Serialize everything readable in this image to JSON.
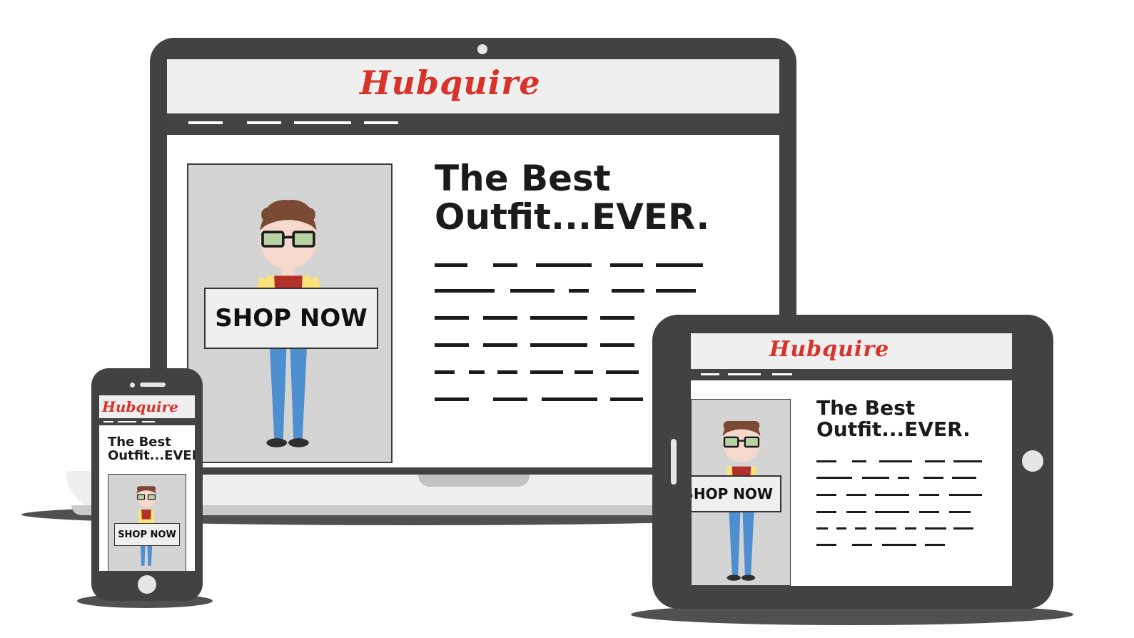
{
  "brand": {
    "logo_text": "Hubquire",
    "logo_color": "#d8332a"
  },
  "laptop": {
    "headline_line1": "The Best",
    "headline_line2": "Outfit...EVER.",
    "cta_label": "SHOP NOW"
  },
  "tablet": {
    "headline_line1": "The Best",
    "headline_line2": "Outfit...EVER.",
    "cta_label": "SHOP NOW"
  },
  "phone": {
    "headline_line1": "The Best",
    "headline_line2": "Outfit...EVER",
    "cta_label": "SHOP NOW"
  },
  "colors": {
    "frame": "#424242",
    "nav_bar": "#434343",
    "header_bg": "#efefef",
    "hero_bg": "#d4d4d4"
  },
  "icons": [
    "camera-icon",
    "home-button-icon",
    "character-illustration",
    "text-placeholder-lines"
  ]
}
